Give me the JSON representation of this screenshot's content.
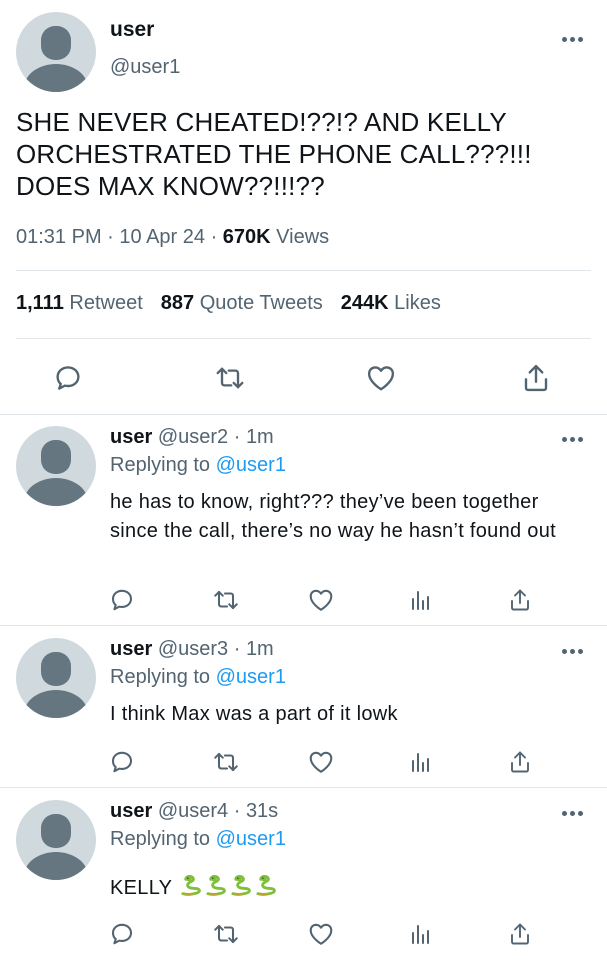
{
  "main_tweet": {
    "display_name": "user",
    "handle": "@user1",
    "text": "SHE NEVER CHEATED!??!? AND KELLY ORCHESTRATED THE PHONE CALL???!!! DOES MAX KNOW??!!!??",
    "time": "01:31 PM",
    "date": "10 Apr 24",
    "views_count": "670K",
    "views_label": "Views",
    "retweet_count": "1,111",
    "retweet_label": "Retweet",
    "quote_count": "887",
    "quote_label": "Quote Tweets",
    "likes_count": "244K",
    "likes_label": "Likes"
  },
  "replies": [
    {
      "display_name": "user",
      "handle": "@user2",
      "age": "1m",
      "replying_prefix": "Replying to",
      "replying_to": "@user1",
      "text": "he has to know, right??? they’ve been together since the call, there’s no way he hasn’t found out"
    },
    {
      "display_name": "user",
      "handle": "@user3",
      "age": "1m",
      "replying_prefix": "Replying to",
      "replying_to": "@user1",
      "text": "I think Max was a part of it lowk"
    },
    {
      "display_name": "user",
      "handle": "@user4",
      "age": "31s",
      "replying_prefix": "Replying to",
      "replying_to": "@user1",
      "text": "KELLY",
      "emoji": "snake-emoji x4"
    }
  ],
  "colors": {
    "text": "#0f1419",
    "secondary": "#536471",
    "link": "#1d9bf0",
    "divider": "#e1e6ea",
    "avatar_bg": "#cfd9de",
    "avatar_fg": "#667680"
  },
  "icons": [
    "more-icon",
    "reply-icon",
    "retweet-icon",
    "like-icon",
    "share-icon",
    "analytics-icon",
    "snake-emoji"
  ]
}
